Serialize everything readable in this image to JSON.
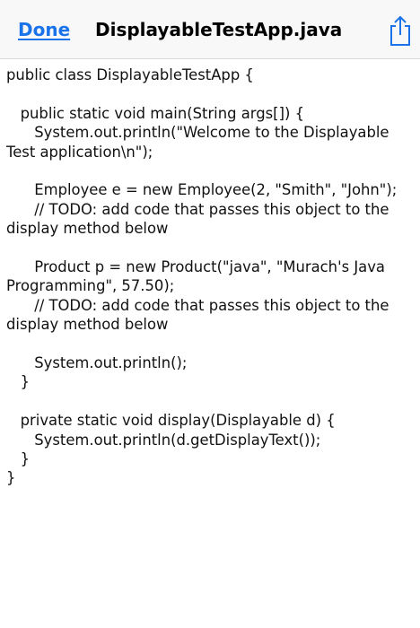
{
  "toolbar": {
    "done_label": "Done",
    "title": "DisplayableTestApp.java",
    "share_icon": "share-icon",
    "accent_color": "#1a73e8"
  },
  "code_lines": [
    "public class DisplayableTestApp {",
    "",
    "   public static void main(String args[]) {",
    "      System.out.println(\"Welcome to the Displayable",
    "Test application\\n\");",
    "",
    "      Employee e = new Employee(2, \"Smith\", \"John\");",
    "      // TODO: add code that passes this object to the",
    "display method below",
    "",
    "      Product p = new Product(\"java\", \"Murach's Java",
    "Programming\", 57.50);",
    "      // TODO: add code that passes this object to the",
    "display method below",
    "",
    "      System.out.println();",
    "   }",
    "",
    "   private static void display(Displayable d) {",
    "      System.out.println(d.getDisplayText());",
    "   }",
    "}"
  ]
}
